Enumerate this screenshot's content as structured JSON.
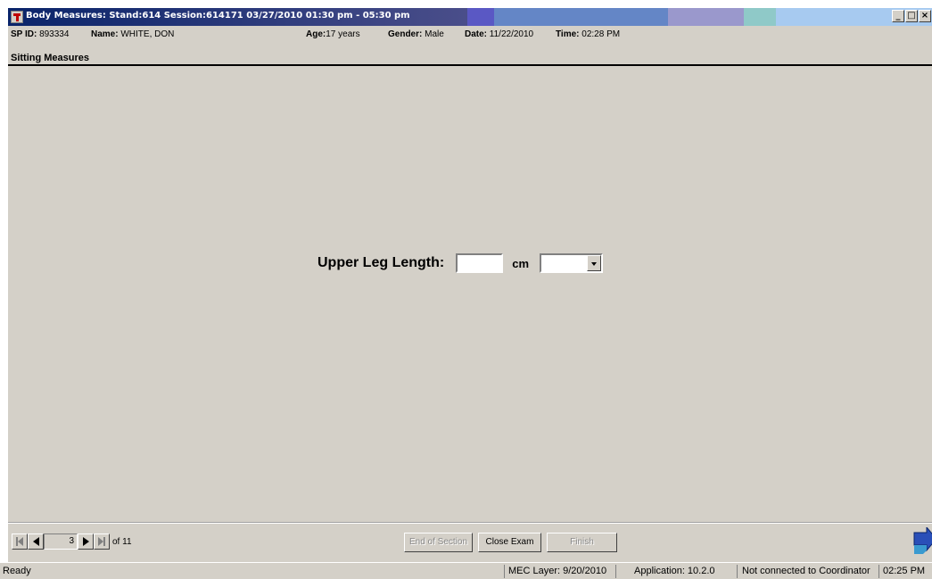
{
  "window": {
    "title": "Body Measures: Stand:614 Session:614171 03/27/2010 01:30 pm - 05:30 pm",
    "title_colors": [
      "#0a246a",
      "#5a58b0",
      "#5f7fc4",
      "#9a98cc",
      "#8fc9c8",
      "#a7caf0"
    ],
    "controls": {
      "minimize": "_",
      "maximize": "□",
      "close": "×"
    }
  },
  "participant": {
    "sp_id_label": "SP ID:",
    "sp_id": "893334",
    "name_label": "Name:",
    "name": "WHITE, DON",
    "age_label": "Age:",
    "age": "17 years",
    "gender_label": "Gender:",
    "gender": "Male",
    "date_label": "Date:",
    "date": "11/22/2010",
    "time_label": "Time:",
    "time": "02:28 PM"
  },
  "section": {
    "title": "Sitting Measures"
  },
  "form": {
    "field_label": "Upper Leg Length:",
    "field_value": "",
    "unit": "cm",
    "comment_selected": ""
  },
  "navigation": {
    "current_page": "3",
    "total_label": "of 11"
  },
  "actions": {
    "end_section": "End of Section",
    "close_exam": "Close Exam",
    "finish": "Finish"
  },
  "statusbar": {
    "status": "Ready",
    "mec_layer": "MEC Layer: 9/20/2010",
    "application": "Application: 10.2.0",
    "coordinator": "Not connected to Coordinator",
    "clock": "02:25 PM"
  },
  "icons": {
    "app": "body-measures-app-icon",
    "next": "next-arrow-icon"
  }
}
